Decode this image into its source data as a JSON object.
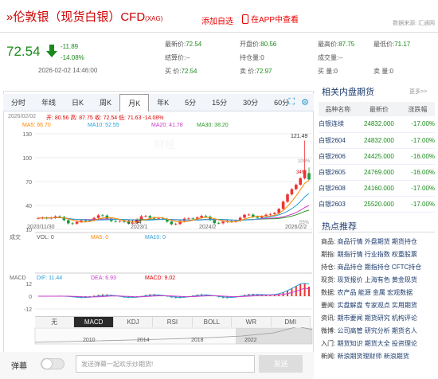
{
  "header": {
    "title": "»伦敦银（现货白银）CFD",
    "code": "(XAG)",
    "watch_label": "添加自选",
    "app_label": "在APP中查看",
    "source_label": "数据来源: 汇通网"
  },
  "quote": {
    "price": "72.54",
    "change": "-11.89",
    "change_pct": "-14.08%",
    "datetime": "2026-02-02 14:46:00",
    "stats": [
      {
        "label": "最新价:",
        "value": "72.54"
      },
      {
        "label": "开盘价:",
        "value": "80.56"
      },
      {
        "label": "最高价:",
        "value": "87.75"
      },
      {
        "label": "最低价:",
        "value": "71.17"
      },
      {
        "label": "结算价:",
        "value": "--"
      },
      {
        "label": "持仓量:",
        "value": "0"
      },
      {
        "label": "成交量:",
        "value": "--"
      },
      {
        "label": "买 价:",
        "value": "72.54"
      },
      {
        "label": "卖 价:",
        "value": "72.97"
      },
      {
        "label": "买 量:",
        "value": "0"
      },
      {
        "label": "卖 量:",
        "value": "0"
      }
    ]
  },
  "chart": {
    "tabs": [
      "分时",
      "年线",
      "日K",
      "周K",
      "月K",
      "年K",
      "5分",
      "15分",
      "30分",
      "60分"
    ],
    "active_tab": "月K",
    "info_date": "2026/02/02",
    "info_ohlc": "开: 80.56 高: 87.75 收: 72.54 低: 71.63 -14.08%",
    "ma5": "MA5: 66.70",
    "ma10": "MA10: 52.55",
    "ma20": "MA20: 41.78",
    "ma30": "MA30: 38.20",
    "y_130": "130",
    "y_100": "100",
    "y_70": "70",
    "y_40": "40",
    "y_10": "10",
    "high_label": "121.49",
    "low_label": "17.54",
    "pct_top": "100%",
    "pct_mid": "34%",
    "pct_low": "55%",
    "x_dates": [
      "2020/11/30",
      "2023/1",
      "2024/2",
      "2026/2/2"
    ],
    "vol_label": "成交",
    "vol": "VOL: 0",
    "vol_ma5": "MA5: 0",
    "vol_ma10": "MA10: 0",
    "macd_label": "MACD",
    "dif": "DIF: 11.44",
    "dea": "DEA: 6.93",
    "macd": "MACD: 9.02",
    "macd_y": [
      "12",
      "0",
      "-12"
    ],
    "indicators": [
      "无",
      "MACD",
      "KDJ",
      "RSI",
      "BOLL",
      "WR",
      "DMI"
    ],
    "active_indicator": "MACD",
    "timeline_years": [
      "2010",
      "2014",
      "2018",
      "2022"
    ]
  },
  "chart_data": {
    "type": "candlestick",
    "title": "伦敦银（现货白银）CFD 月K",
    "ylim": [
      10,
      130
    ],
    "high": 121.49,
    "low": 17.54,
    "last": {
      "date": "2026/02/02",
      "open": 80.56,
      "high": 87.75,
      "close": 72.54,
      "low": 71.63,
      "change_pct": -14.08
    },
    "moving_averages": [
      {
        "name": "MA5",
        "value": 66.7,
        "color": "#ff8800"
      },
      {
        "name": "MA10",
        "value": 52.55,
        "color": "#2aa0d8"
      },
      {
        "name": "MA20",
        "value": 41.78,
        "color": "#c83cc8"
      },
      {
        "name": "MA30",
        "value": 38.2,
        "color": "#2a9a2a"
      }
    ],
    "macd": {
      "dif": 11.44,
      "dea": 6.93,
      "macd": 9.02
    }
  },
  "danmu": {
    "label": "弹幕",
    "placeholder": "发送弹幕一起欢乐炒期货!",
    "send_label": "发送"
  },
  "futures": {
    "title": "相关内盘期货",
    "more_label": "更多>>",
    "columns": [
      "品种名称",
      "最新价",
      "涨跌幅"
    ],
    "rows": [
      {
        "name": "白银连续",
        "price": "24832.000",
        "pct": "-17.00%"
      },
      {
        "name": "白银2604",
        "price": "24832.000",
        "pct": "-17.00%"
      },
      {
        "name": "白银2606",
        "price": "24425.000",
        "pct": "-16.00%"
      },
      {
        "name": "白银2605",
        "price": "24769.000",
        "pct": "-16.00%"
      },
      {
        "name": "白银2608",
        "price": "24160.000",
        "pct": "-17.00%"
      },
      {
        "name": "白银2603",
        "price": "25520.000",
        "pct": "-17.00%"
      }
    ]
  },
  "recommend": {
    "title": "热点推荐",
    "rows": [
      {
        "key": "商品:",
        "links": "商品行情 外盘期货 期货持仓"
      },
      {
        "key": "期指:",
        "links": "期指行情 行业指数 权重股票"
      },
      {
        "key": "持仓:",
        "links": "商品持仓 期指持仓 CFTC持仓"
      },
      {
        "key": "现货:",
        "links": "现货报价 上海有色 黄金现货"
      },
      {
        "key": "数据:",
        "links": "农产品 能源 金属 宏观数据"
      },
      {
        "key": "要闻:",
        "links": "实盘解盘 专家观点 实用期货"
      },
      {
        "key": "资讯:",
        "links": "期市要闻 期货研究 机构评论"
      },
      {
        "key": "微博:",
        "links": "公司高管 研究分析 期货名人"
      },
      {
        "key": "入门:",
        "links": "期货知识 期货大全 投资理论"
      },
      {
        "key": "新闻:",
        "links": "新浪期货理财师 新浪期货"
      }
    ]
  }
}
